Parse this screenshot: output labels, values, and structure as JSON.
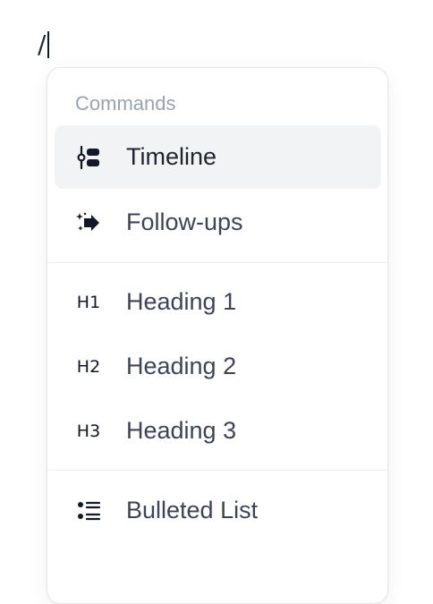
{
  "editor": {
    "typed_text": "/"
  },
  "menu": {
    "section_title": "Commands",
    "items": [
      {
        "label": "Timeline",
        "icon": "timeline-icon",
        "active": true
      },
      {
        "label": "Follow-ups",
        "icon": "follow-ups-icon",
        "active": false
      },
      {
        "label": "Heading 1",
        "icon": "heading-1-icon",
        "icon_text": "H1",
        "active": false
      },
      {
        "label": "Heading 2",
        "icon": "heading-2-icon",
        "icon_text": "H2",
        "active": false
      },
      {
        "label": "Heading 3",
        "icon": "heading-3-icon",
        "icon_text": "H3",
        "active": false
      },
      {
        "label": "Bulleted List",
        "icon": "bulleted-list-icon",
        "active": false
      }
    ]
  },
  "colors": {
    "active_background": "#f2f3f5",
    "label_text": "#3c4556",
    "section_title": "#9ca3af",
    "icon": "#111827"
  }
}
